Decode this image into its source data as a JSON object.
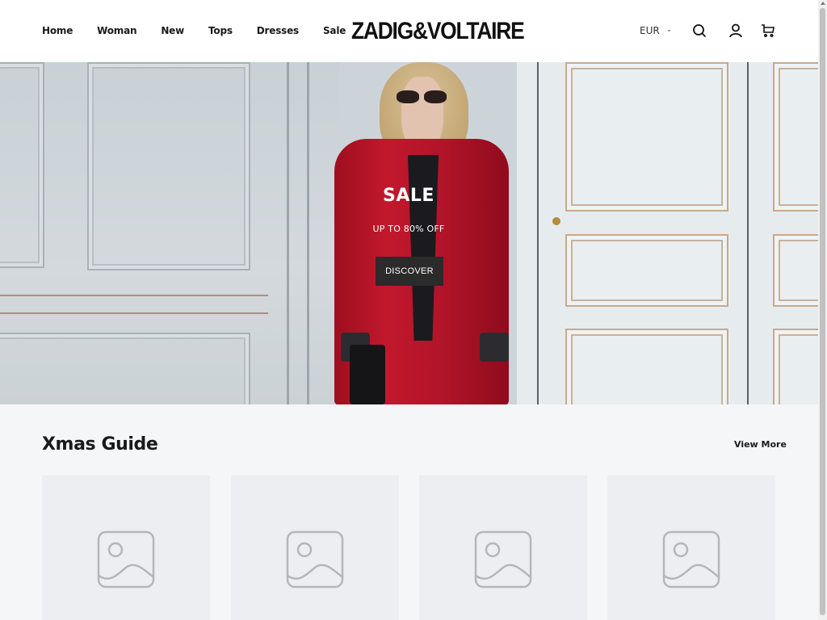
{
  "header": {
    "nav": [
      {
        "label": "Home"
      },
      {
        "label": "Woman"
      },
      {
        "label": "New"
      },
      {
        "label": "Tops"
      },
      {
        "label": "Dresses"
      },
      {
        "label": "Sale"
      }
    ],
    "logo": "ZADIG&VOLTAIRE",
    "currency": {
      "selected": "EUR",
      "icon": "chevron-down-icon"
    },
    "icons": [
      "search-icon",
      "user-icon",
      "cart-icon"
    ]
  },
  "hero": {
    "title": "SALE",
    "subtitle": "UP TO 80% OFF",
    "cta_label": "DISCOVER",
    "image_alt": "Model in red velvet suit in front of paneled white doors"
  },
  "section": {
    "title": "Xmas Guide",
    "view_more_label": "View More",
    "cards": [
      {
        "image": "image-placeholder-icon"
      },
      {
        "image": "image-placeholder-icon"
      },
      {
        "image": "image-placeholder-icon"
      },
      {
        "image": "image-placeholder-icon"
      }
    ]
  },
  "colors": {
    "button_bg": "#2b2b2b",
    "page_bg": "#f5f6f8",
    "card_bg": "#eceef1",
    "accent_red": "#b3142a"
  }
}
